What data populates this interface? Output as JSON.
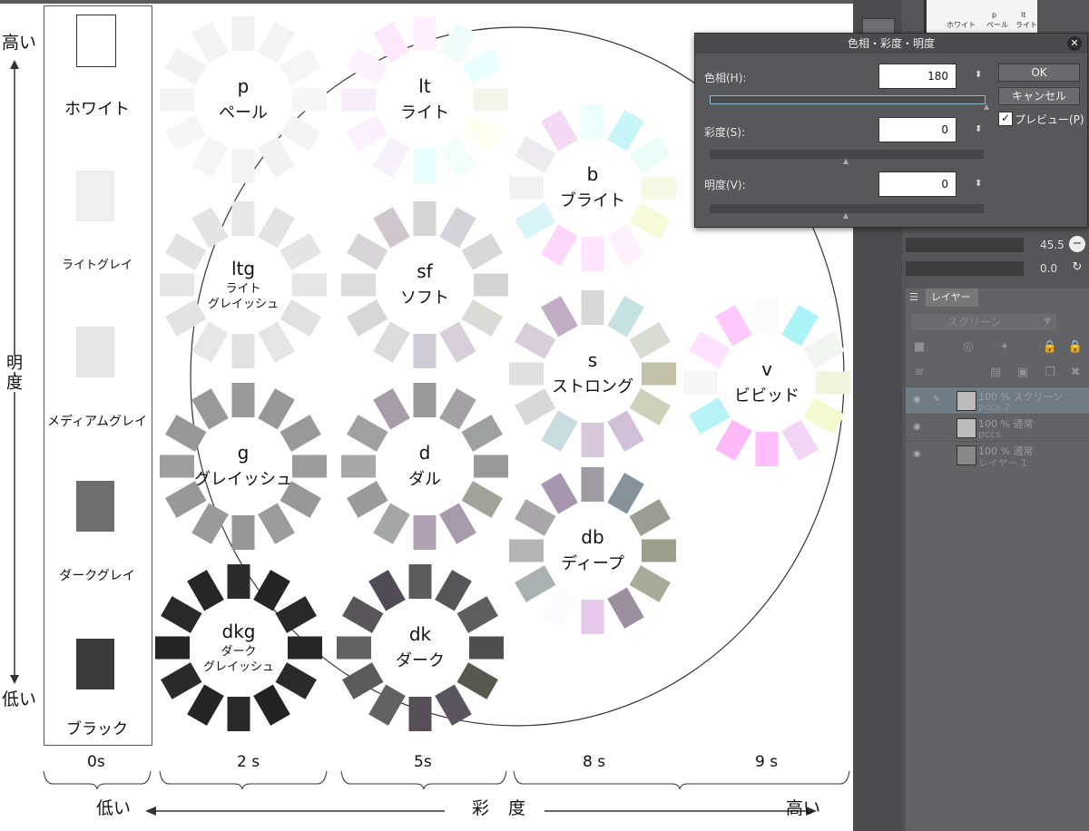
{
  "axis": {
    "vertical_high": "高い",
    "vertical_low": "低い",
    "vertical_title_1": "明",
    "vertical_title_2": "度",
    "horizontal_low": "低い",
    "horizontal_title_1": "彩",
    "horizontal_title_2": "度",
    "horizontal_high": "高い",
    "saturation_ticks": [
      "0s",
      "2 s",
      "5s",
      "8 s",
      "9 s"
    ]
  },
  "grays": [
    {
      "label": "ホワイト",
      "color": "#ffffff"
    },
    {
      "label": "ライトグレイ",
      "color": "#efefef"
    },
    {
      "label": "メディアムグレイ",
      "color": "#e6e6e6"
    },
    {
      "label": "ダークグレイ",
      "color": "#6e6e6e"
    },
    {
      "label": "ブラック",
      "color": "#3a3a3a"
    }
  ],
  "tones": [
    {
      "code": "p",
      "name": "ペール",
      "colors": [
        "#f1f1f1",
        "#f3f3f3",
        "#f5f5f5",
        "#f6f6f6",
        "#f4f4f4",
        "#f2f2f2",
        "#f3f3f3",
        "#f5f5f5",
        "#f6f6f6",
        "#f4f4f4",
        "#f2f2f2",
        "#f3f3f3"
      ]
    },
    {
      "code": "lt",
      "name": "ライト",
      "colors": [
        "#fdf0fc",
        "#eefcfc",
        "#eaffff",
        "#f5f5ea",
        "#fffff0",
        "#f2fff8",
        "#e8fffe",
        "#f8f0fb",
        "#fbf0ff",
        "#f6eefb",
        "#fcf0fc",
        "#ffe8fb"
      ]
    },
    {
      "code": "b",
      "name": "ブライト",
      "colors": [
        "#ecffff",
        "#c8f5f7",
        "#eafdfa",
        "#f8f9e4",
        "#f7f9d8",
        "#fff0fd",
        "#ffe4ff",
        "#ffd6fb",
        "#d9f4f6",
        "#f1f1f1",
        "#efeaf1",
        "#f5d8f4"
      ]
    },
    {
      "code": "ltg",
      "name": "ライト\nグレイッシュ",
      "small": true,
      "colors": [
        "#e7e7e7",
        "#e3e3e3",
        "#e4e4e4",
        "#e6e6e6",
        "#e1e1e1",
        "#e5e5e5",
        "#e2e2e2",
        "#e7e7e7",
        "#e3e3e3",
        "#e6e6e6",
        "#e2e2e2",
        "#e4e4e4"
      ]
    },
    {
      "code": "sf",
      "name": "ソフト",
      "colors": [
        "#d6d6d6",
        "#d5d2da",
        "#d7d9d7",
        "#d3d3d3",
        "#d9dbd5",
        "#d8cfdb",
        "#d1cbd4",
        "#d9dcda",
        "#d7d7d7",
        "#dcdcdc",
        "#d9d4da",
        "#d0c6cf"
      ]
    },
    {
      "code": "s",
      "name": "ストロング",
      "colors": [
        "#d8d8d8",
        "#c6e1e1",
        "#d7ddd3",
        "#c2c1a8",
        "#cdd0bb",
        "#d1bed7",
        "#d7c7db",
        "#c9dde1",
        "#d8d8d8",
        "#e0e0e0",
        "#d7cddb",
        "#c1aec4"
      ]
    },
    {
      "code": "v",
      "name": "ビビッド",
      "colors": [
        "#fbfbfb",
        "#aaf4f8",
        "#f0f5ef",
        "#f1f3dc",
        "#f6f9d0",
        "#f3d6f5",
        "#ffbfff",
        "#ffb9f8",
        "#b7f3f7",
        "#f6f6f6",
        "#fde1ff",
        "#ffc8fa"
      ]
    },
    {
      "code": "g",
      "name": "グレイッシュ",
      "colors": [
        "#9a9a9a",
        "#979797",
        "#999999",
        "#9c9c9c",
        "#989898",
        "#9b9b9b",
        "#969696",
        "#9a9a9a",
        "#989898",
        "#9d9d9d",
        "#979797",
        "#999999"
      ]
    },
    {
      "code": "d",
      "name": "ダル",
      "colors": [
        "#9a9a9a",
        "#a4a0a5",
        "#9ca19d",
        "#9a9a9a",
        "#a0a39a",
        "#a79aaa",
        "#b0a2b3",
        "#a4a8a4",
        "#9a9a9a",
        "#a8a8a8",
        "#a0a0a0",
        "#a79da8"
      ]
    },
    {
      "code": "db",
      "name": "ディープ",
      "colors": [
        "#a09aa2",
        "#86929a",
        "#9c9c92",
        "#9d9e8c",
        "#a8ab98",
        "#9b8f9f",
        "#e6c8ea",
        "#fdfbff",
        "#aab1b3",
        "#b4b4b4",
        "#aaa6ab",
        "#a896ae"
      ]
    },
    {
      "code": "dkg",
      "name": "ダーク\nグレイッシュ",
      "small": true,
      "colors": [
        "#2b2b2b",
        "#242424",
        "#292929",
        "#262626",
        "#2a2a2a",
        "#232323",
        "#282828",
        "#252525",
        "#2b2b2b",
        "#242424",
        "#292929",
        "#262626"
      ]
    },
    {
      "code": "dk",
      "name": "ダーク",
      "colors": [
        "#5c5c5c",
        "#58555a",
        "#5c5f5c",
        "#4f4f4f",
        "#57594f",
        "#5c5360",
        "#574e5a",
        "#606360",
        "#5b5b5b",
        "#626262",
        "#5a555b",
        "#524a54"
      ]
    }
  ],
  "dialog": {
    "title": "色相・彩度・明度",
    "hue_label": "色相(H):",
    "hue_value": "180",
    "saturation_label": "彩度(S):",
    "saturation_value": "0",
    "value_label": "明度(V):",
    "value_value": "0",
    "ok": "OK",
    "cancel": "キャンセル",
    "preview": "プレビュー(P)",
    "preview_checked": true
  },
  "app_panel": {
    "brush_size": "45.5",
    "brush_opacity": "0.0",
    "layer_tab": "レイヤー",
    "blend_mode": "スクリーン",
    "layers": [
      {
        "line1": "100 % スクリーン",
        "line2": "pccs 2",
        "selected": true
      },
      {
        "line1": "100 % 通常",
        "line2": "pccs",
        "selected": false
      },
      {
        "line1": "100 % 通常",
        "line2": "レイヤー 1",
        "selected": false
      }
    ],
    "thumb_labels": [
      "p",
      "ペール",
      "lt",
      "ライト",
      "ホワイト"
    ]
  }
}
